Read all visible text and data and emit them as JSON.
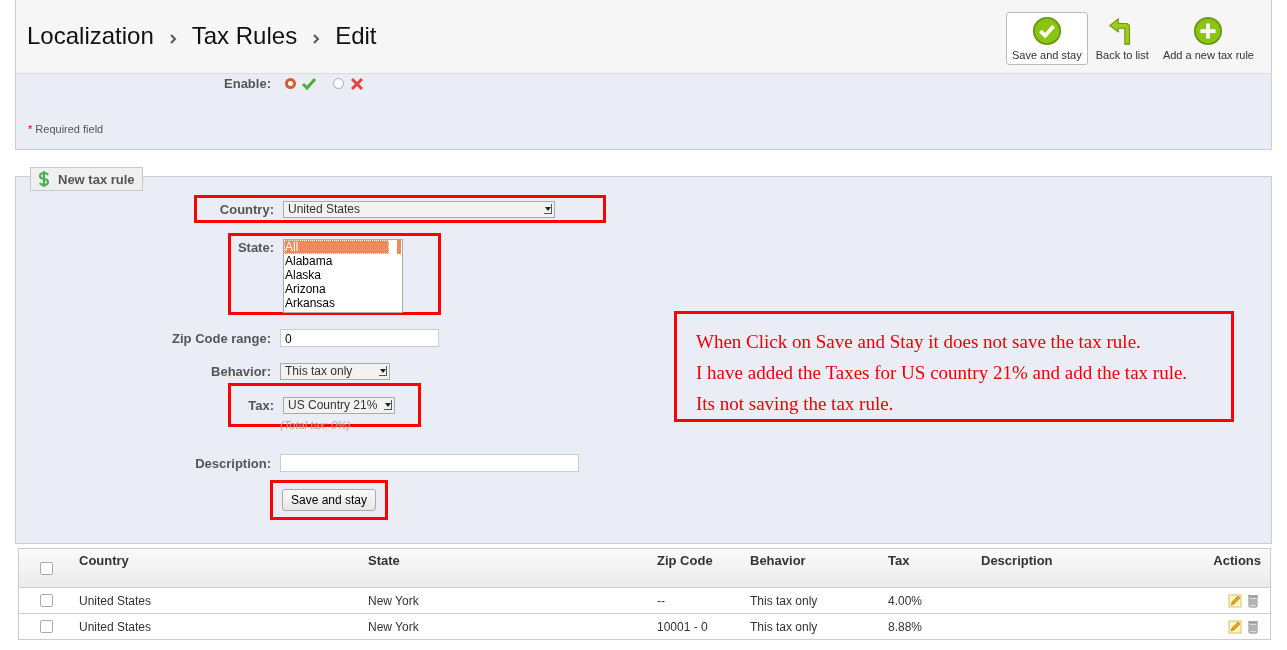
{
  "breadcrumb": [
    "Localization",
    "Tax Rules",
    "Edit"
  ],
  "toolbar": [
    {
      "label": "Save and stay",
      "kind": "save",
      "selected": true
    },
    {
      "label": "Back to list",
      "kind": "back",
      "selected": false
    },
    {
      "label": "Add a new tax rule",
      "kind": "add",
      "selected": false
    }
  ],
  "tax_rules_section": {
    "enable_label": "Enable:",
    "enable_options": [
      {
        "kind": "yes",
        "selected": true
      },
      {
        "kind": "no",
        "selected": false
      }
    ],
    "required_mark": "*",
    "required_note": "Required field"
  },
  "new_rule": {
    "legend": "New tax rule",
    "country_label": "Country:",
    "country_value": "United States",
    "state_label": "State:",
    "states": [
      {
        "label": "All",
        "selected": true
      },
      {
        "label": "Alabama",
        "selected": false
      },
      {
        "label": "Alaska",
        "selected": false
      },
      {
        "label": "Arizona",
        "selected": false
      },
      {
        "label": "Arkansas",
        "selected": false
      }
    ],
    "zip_label": "Zip Code range:",
    "zip_value": "0",
    "behavior_label": "Behavior:",
    "behavior_value": "This tax only",
    "tax_label": "Tax:",
    "tax_value": "US Country 21%",
    "total_tax": "(Total tax: 0%)",
    "description_label": "Description:",
    "save_button": "Save and stay"
  },
  "note": [
    "When Click on Save and Stay it does not save the tax rule.",
    "I have added the Taxes for US country 21% and add the tax rule.",
    "Its not saving the tax rule."
  ],
  "table": {
    "select_all_checked": false,
    "columns": [
      "Country",
      "State",
      "Zip Code",
      "Behavior",
      "Tax",
      "Description",
      "Actions"
    ],
    "rows": [
      {
        "checked": false,
        "cells": [
          "United States",
          "New York",
          "--",
          "This tax only",
          "4.00%",
          ""
        ]
      },
      {
        "checked": false,
        "cells": [
          "United States",
          "New York",
          "10001 - 0",
          "This tax only",
          "8.88%",
          ""
        ]
      }
    ]
  }
}
